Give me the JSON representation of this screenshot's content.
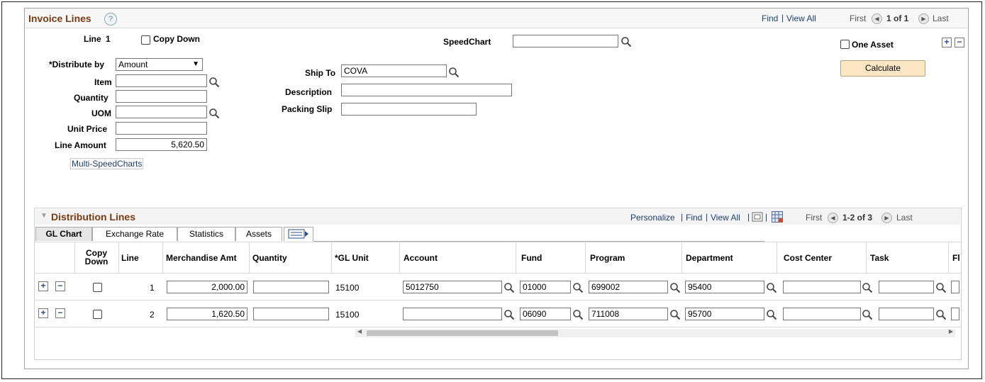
{
  "invoice_lines": {
    "title": "Invoice Lines",
    "nav": {
      "find": "Find",
      "sep": "|",
      "view_all": "View All",
      "first": "First",
      "range": "1 of 1",
      "last": "Last"
    },
    "line_label": "Line",
    "line_number": "1",
    "copy_down": "Copy Down",
    "speedchart_label": "SpeedChart",
    "speedchart_value": "",
    "one_asset": "One Asset",
    "calculate": "Calculate",
    "distribute_by_label": "*Distribute by",
    "distribute_by_value": "Amount",
    "item_label": "Item",
    "item_value": "",
    "quantity_label": "Quantity",
    "quantity_value": "",
    "uom_label": "UOM",
    "uom_value": "",
    "unit_price_label": "Unit Price",
    "unit_price_value": "",
    "line_amount_label": "Line Amount",
    "line_amount_value": "5,620.50",
    "multi_speedcharts": "Multi-SpeedCharts",
    "ship_to_label": "Ship To",
    "ship_to_value": "COVA",
    "description_label": "Description",
    "description_value": "",
    "packing_slip_label": "Packing Slip",
    "packing_slip_value": ""
  },
  "distribution_lines": {
    "title": "Distribution Lines",
    "nav": {
      "personalize": "Personalize",
      "find": "Find",
      "view_all": "View All",
      "sep": "|",
      "first": "First",
      "range": "1-2 of 3",
      "last": "Last"
    },
    "tabs": [
      "GL Chart",
      "Exchange Rate",
      "Statistics",
      "Assets"
    ],
    "columns": [
      "Copy Down",
      "Line",
      "Merchandise Amt",
      "Quantity",
      "*GL Unit",
      "Account",
      "Fund",
      "Program",
      "Department",
      "Cost Center",
      "Task",
      "Fl"
    ],
    "rows": [
      {
        "line": "1",
        "merch_amt": "2,000.00",
        "quantity": "",
        "gl_unit": "15100",
        "account": "5012750",
        "fund": "01000",
        "program": "699002",
        "department": "95400",
        "cost_center": "",
        "task": ""
      },
      {
        "line": "2",
        "merch_amt": "1,620.50",
        "quantity": "",
        "gl_unit": "15100",
        "account": "",
        "fund": "06090",
        "program": "711008",
        "department": "95700",
        "cost_center": "",
        "task": ""
      }
    ]
  },
  "colors": {
    "title": "#7a3b12",
    "link": "#1d3f71",
    "button": "#fbe7c3"
  }
}
